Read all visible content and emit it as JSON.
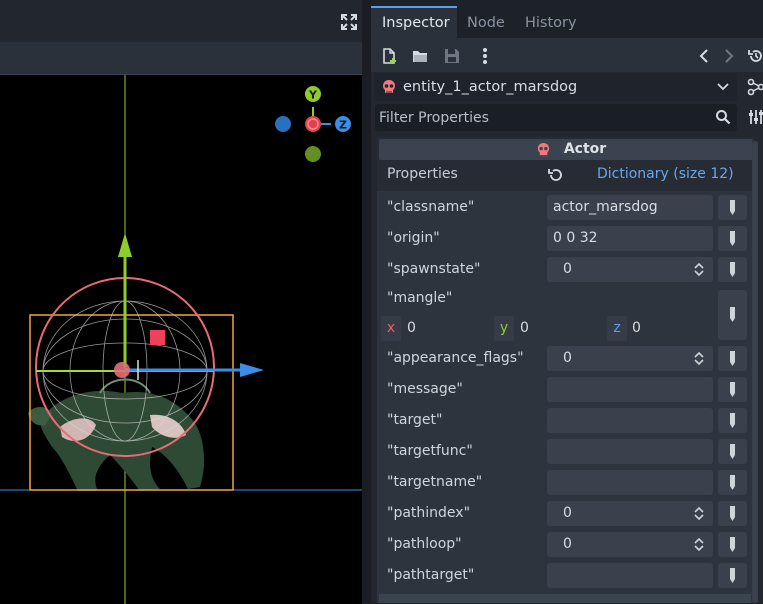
{
  "tabs": [
    {
      "label": "Inspector",
      "active": true
    },
    {
      "label": "Node",
      "active": false
    },
    {
      "label": "History",
      "active": false
    }
  ],
  "toolbar": {
    "icons": [
      "new-resource-icon",
      "open-folder-icon",
      "save-icon",
      "more-options-icon",
      "history-back-icon",
      "history-forward-icon",
      "object-history-icon"
    ]
  },
  "object": {
    "name": "entity_1_actor_marsdog",
    "icon": "actor-skull-icon"
  },
  "filter": {
    "placeholder": "Filter Properties"
  },
  "section": {
    "title": "Actor"
  },
  "properties": {
    "label": "Properties",
    "dict_label": "Dictionary (size 12)"
  },
  "dictionary": {
    "classname": {
      "key": "\"classname\"",
      "value": "actor_marsdog"
    },
    "origin": {
      "key": "\"origin\"",
      "value": "0 0 32"
    },
    "spawnstate": {
      "key": "\"spawnstate\"",
      "value": "0"
    },
    "mangle": {
      "key": "\"mangle\"",
      "x_label": "x",
      "x": "0",
      "y_label": "y",
      "y": "0",
      "z_label": "z",
      "z": "0"
    },
    "appearance_flags": {
      "key": "\"appearance_flags\"",
      "value": "0"
    },
    "message": {
      "key": "\"message\"",
      "value": ""
    },
    "target": {
      "key": "\"target\"",
      "value": ""
    },
    "targetfunc": {
      "key": "\"targetfunc\"",
      "value": ""
    },
    "targetname": {
      "key": "\"targetname\"",
      "value": ""
    },
    "pathindex": {
      "key": "\"pathindex\"",
      "value": "0"
    },
    "pathloop": {
      "key": "\"pathloop\"",
      "value": "0"
    },
    "pathtarget": {
      "key": "\"pathtarget\"",
      "value": ""
    }
  },
  "gizmo": {
    "y_label": "Y",
    "z_label": "Z"
  },
  "colors": {
    "accent": "#5a9ef2",
    "x_axis": "#e5404c",
    "y_axis": "#8fcc2e",
    "z_axis": "#3a8ee6",
    "selection_box": "#f0a53a"
  }
}
